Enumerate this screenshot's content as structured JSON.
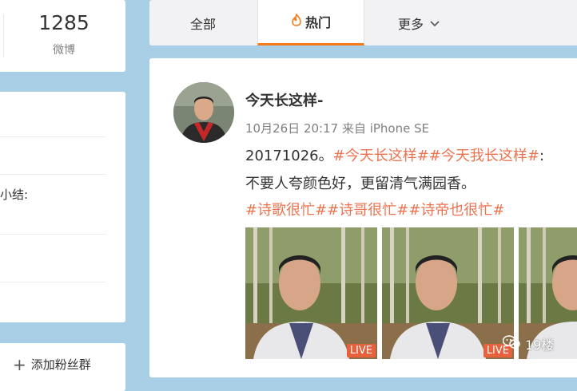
{
  "left": {
    "stat_count": "1285",
    "stat_label": "微博",
    "snippet": "小结:",
    "add_label": "添加粉丝群"
  },
  "tabs": {
    "all": "全部",
    "hot": "热门",
    "more": "更多"
  },
  "post": {
    "username": "今天长这样-",
    "meta": "10月26日 20:17 来自 iPhone SE",
    "line1_plain": "20171026。",
    "line1_tag1": "#今天长这样#",
    "line1_tag2": "#今天我长这样#",
    "line1_tail": ":",
    "line2": "不要人夸颜色好，更留清气满园香。",
    "line3_tag1": "#诗歌很忙#",
    "line3_tag2": "#诗哥很忙#",
    "line3_tag3": "#诗帝也很忙#",
    "live_badge": "LIVE"
  },
  "watermark": "19楼",
  "colors": {
    "background": "#a9cfe6",
    "accent": "#f77b1b",
    "topic": "#eb7350",
    "live": "#e8603c"
  },
  "icons": [
    "flame-icon",
    "chevron-down-icon",
    "plus-icon",
    "wechat-icon"
  ]
}
